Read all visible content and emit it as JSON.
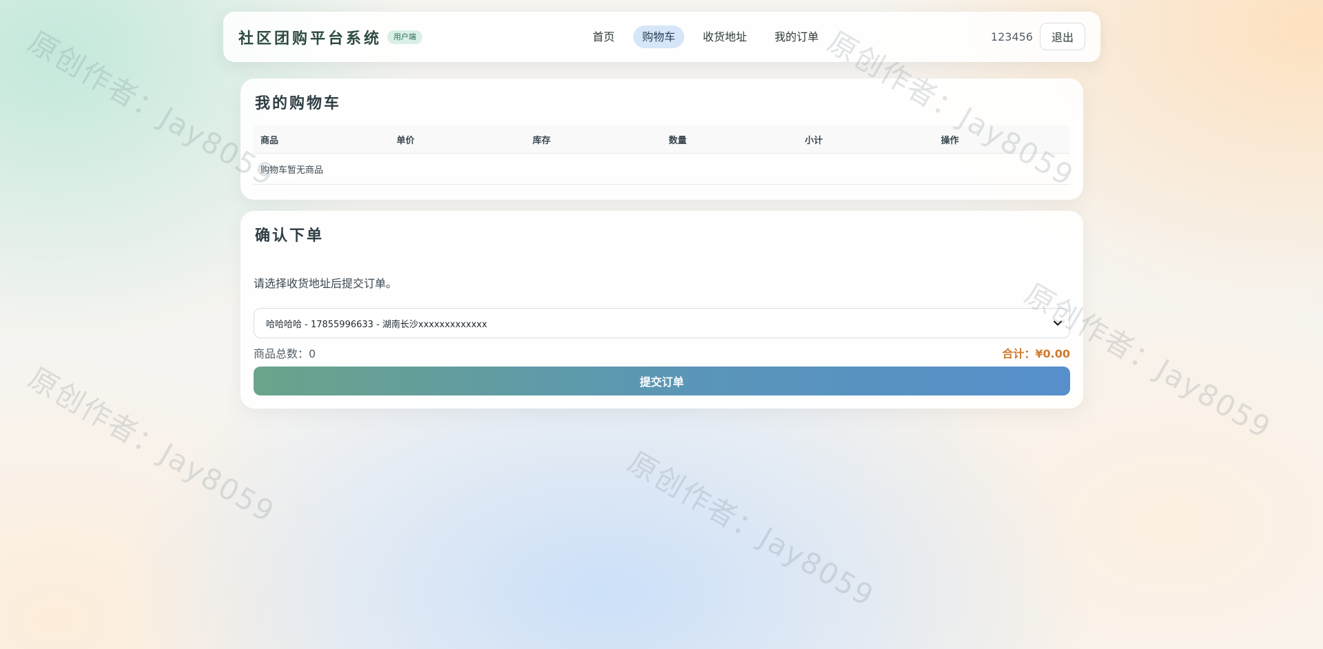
{
  "header": {
    "brand_title": "社区团购平台系统",
    "brand_badge": "用户端",
    "nav": [
      "首页",
      "购物车",
      "收货地址",
      "我的订单"
    ],
    "active_nav": "购物车",
    "username": "123456",
    "logout_label": "退出"
  },
  "cart": {
    "title": "我的购物车",
    "columns": [
      "商品",
      "单价",
      "库存",
      "数量",
      "小计",
      "操作"
    ],
    "empty_message": "购物车暂无商品"
  },
  "order": {
    "title": "确认下单",
    "hint": "请选择收货地址后提交订单。",
    "selected_address": "哈哈哈哈 - 17855996633 - 湖南长沙xxxxxxxxxxxxx",
    "count_label": "商品总数：",
    "count_value": "0",
    "total_label": "合计：",
    "total_value": "¥0.00",
    "submit_label": "提交订单"
  },
  "watermark_text": "原创作者：Jay8059",
  "colors": {
    "active_nav_bg": "#d6e6f8",
    "badge_bg": "#d9f0e6",
    "total_text": "#d07a2c",
    "submit_gradient_start": "#6aa48a",
    "submit_gradient_end": "#568fcb"
  }
}
